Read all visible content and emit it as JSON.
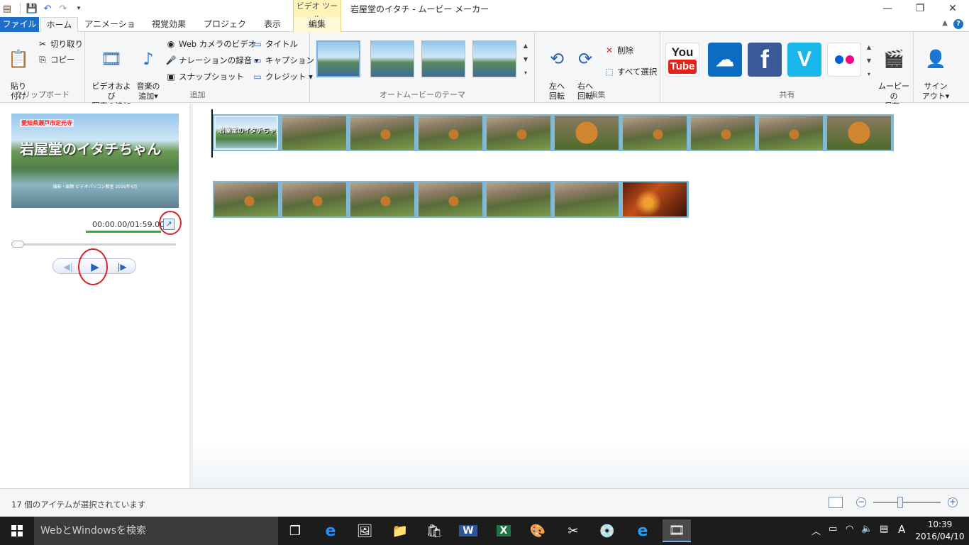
{
  "window": {
    "title": "岩屋堂のイタチ - ムービー メーカー",
    "contextual_tab_group": "ビデオ ツール",
    "minimize": "—",
    "maximize": "❐",
    "close": "✕"
  },
  "tabs": [
    {
      "label": "ファイル"
    },
    {
      "label": "ホーム"
    },
    {
      "label": "アニメーション"
    },
    {
      "label": "視覚効果"
    },
    {
      "label": "プロジェクト"
    },
    {
      "label": "表示"
    },
    {
      "label": "編集"
    }
  ],
  "ribbon": {
    "clipboard": {
      "label": "クリップボード",
      "paste": "貼り\n付け",
      "cut": "切り取り",
      "copy": "コピー"
    },
    "add": {
      "label": "追加",
      "add_video_photo": "ビデオおよび\n写真の追加",
      "add_music": "音楽の\n追加▾",
      "webcam_video": "Web カメラのビデオ",
      "record_narration": "ナレーションの録音 ▾",
      "snapshot": "スナップショット",
      "title": "タイトル",
      "caption": "キャプション",
      "credits": "クレジット ▾"
    },
    "automovie": {
      "label": "オートムービーのテーマ"
    },
    "edit": {
      "label": "編集",
      "rotate_left": "左へ\n回転",
      "rotate_right": "右へ\n回転",
      "delete": "削除",
      "select_all": "すべて選択"
    },
    "share": {
      "label": "共有",
      "youtube_line1": "You",
      "youtube_line2": "Tube",
      "facebook": "f",
      "vimeo": "V",
      "save_movie": "ムービーの\n保存▾"
    },
    "signout": {
      "label": "サイン\nアウト▾"
    }
  },
  "preview": {
    "overlay_top": "愛知県瀬戸市定光寺",
    "overlay_title": "岩屋堂のイタチちゃん",
    "overlay_bottom": "撮影・編集 ビデオパソコン教室 2016年4月",
    "time": "00:00.00/01:59.00"
  },
  "storyboard": {
    "title_clip_text": "岩屋堂のイタチちゃん"
  },
  "status": {
    "text": "17 個のアイテムが選択されています"
  },
  "taskbar": {
    "search_placeholder": "WebとWindowsを検索",
    "ime": "A",
    "time": "10:39",
    "date": "2016/04/10"
  }
}
